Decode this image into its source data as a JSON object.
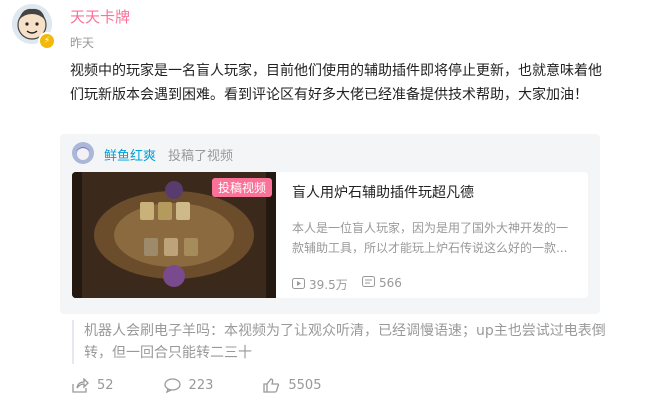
{
  "user": {
    "name": "天天卡牌",
    "time": "昨天",
    "verified": true
  },
  "post": {
    "text": "视频中的玩家是一名盲人玩家，目前他们使用的辅助插件即将停止更新，也就意味着他们玩新版本会遇到困难。看到评论区有好多大佬已经准备提供技术帮助，大家加油！"
  },
  "shared": {
    "sharer": "鲜鱼红爽",
    "action": "投稿了视频",
    "badge": "投稿视频",
    "title": "盲人用炉石辅助插件玩超凡德",
    "description": "本人是一位盲人玩家，因为是用了国外大神开发的一款辅助工具，所以才能玩上炉石传说这么好的一款...",
    "play_count": "39.5万",
    "danmaku_count": "566"
  },
  "top_comment": {
    "author": "机器人会刷电子羊吗",
    "colon": "：",
    "text": "本视频为了让观众听清，已经调慢语速；up主也尝试过电表倒转，但一回合只能转二三十"
  },
  "actions": {
    "share_count": "52",
    "comment_count": "223",
    "like_count": "5505"
  },
  "colors": {
    "accent_pink": "#fb7299",
    "link_blue": "#00a1d6",
    "muted": "#999999"
  }
}
